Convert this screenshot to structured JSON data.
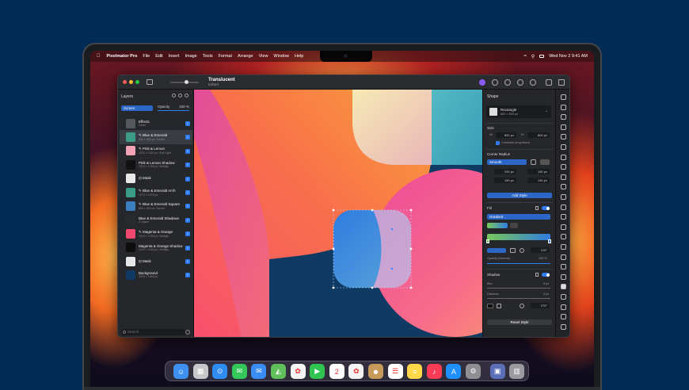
{
  "menubar": {
    "apple_icon": "apple-logo",
    "app_name": "Pixelmator Pro",
    "items": [
      "File",
      "Edit",
      "Insert",
      "Image",
      "Tools",
      "Format",
      "Arrange",
      "View",
      "Window",
      "Help"
    ],
    "datetime": "Wed Nov 2  9:41 AM"
  },
  "window": {
    "title": "Translucent",
    "subtitle": "Edited"
  },
  "layers_panel": {
    "title": "Layers",
    "blend_mode": "Screen",
    "opacity_label": "Opacity",
    "opacity_value": "100 %",
    "opacity_level": 1.0,
    "layers": [
      {
        "name": "Effects",
        "sub": "Glass",
        "thumb": "#55575c",
        "selected": false
      },
      {
        "name": "✎ Blue & Emerald",
        "sub": "800 × 800 px, Screen",
        "thumb": "#3d9a86",
        "selected": true
      },
      {
        "name": "✎ Pink & Lemon",
        "sub": "1024 × 1024 px, Soft Light",
        "thumb": "#f3a1b5",
        "selected": false
      },
      {
        "name": "Pink & Lemon Shadow",
        "sub": "1024 × 1024 px, Multiply",
        "thumb": "#111111",
        "selected": false
      },
      {
        "name": "⊡ Mask",
        "sub": "",
        "thumb": "#e8e8e8",
        "selected": false
      },
      {
        "name": "✎ Blue & Emerald Arch",
        "sub": "1074 × 1075 px",
        "thumb": "#3a9c84",
        "selected": false
      },
      {
        "name": "✎ Blue & Emerald Square",
        "sub": "800 × 800 px, Screen",
        "thumb": "#3b7fbf",
        "selected": false
      },
      {
        "name": "Blue & Emerald Shadows",
        "sub": "2 Layers",
        "thumb": "#2a2b2f",
        "selected": false
      },
      {
        "name": "✎ Magenta & Orange",
        "sub": "1024 × 1024 px, Multiply",
        "thumb": "#f0486f",
        "selected": false
      },
      {
        "name": "Magenta & Orange Shadow",
        "sub": "1024 × 1024 px, Multiply",
        "thumb": "#0d0d0d",
        "selected": false
      },
      {
        "name": "⊡ Mask",
        "sub": "",
        "thumb": "#e8e8e8",
        "selected": false
      },
      {
        "name": "Background",
        "sub": "3024 × 1964 px",
        "thumb": "#0f3a63",
        "selected": false
      }
    ],
    "search_placeholder": "Search"
  },
  "inspector": {
    "title": "Shape",
    "shape_name": "Rectangle",
    "shape_sub": "800 × 800 px",
    "size_label": "Size",
    "w_label": "W:",
    "w_value": "800 px",
    "h_label": "H:",
    "h_value": "800 px",
    "constrain_label": "Constrain proportions",
    "corner_label": "Corner Radius",
    "corner_mode": "Smooth",
    "corner_values": [
      "200 px",
      "150 px",
      "150 px",
      "150 px"
    ],
    "add_style_label": "Add Style",
    "fill_label": "Fill",
    "fill_type": "Gradient",
    "angle_value": "120°",
    "opacity_label": "Opacity (Normal)",
    "opacity_value": "100 %",
    "shadow_label": "Shadow",
    "blur_label": "Blur",
    "blur_value": "5 px",
    "distance_label": "Distance",
    "distance_value": "5 px",
    "shadow_angle": "270°",
    "reset_label": "Reset Style"
  },
  "dock": {
    "apps": [
      {
        "name": "finder-icon",
        "color": "#3d8ff0",
        "glyph": "☺"
      },
      {
        "name": "launchpad-icon",
        "color": "#c8c8cc",
        "glyph": "▦"
      },
      {
        "name": "safari-icon",
        "color": "#2f8cf3",
        "glyph": "⊙"
      },
      {
        "name": "messages-icon",
        "color": "#34c759",
        "glyph": "✉"
      },
      {
        "name": "mail-icon",
        "color": "#3a8cf5",
        "glyph": "✉"
      },
      {
        "name": "maps-icon",
        "color": "#5fbf5b",
        "glyph": "◭"
      },
      {
        "name": "photos-icon",
        "color": "#f4f4f4",
        "glyph": "✿"
      },
      {
        "name": "facetime-icon",
        "color": "#30c550",
        "glyph": "▶"
      },
      {
        "name": "calendar-icon",
        "color": "#ffffff",
        "glyph": "2"
      },
      {
        "name": "pixelmator-icon",
        "color": "#f3f3f3",
        "glyph": "✿"
      },
      {
        "name": "contacts-icon",
        "color": "#c69a5b",
        "glyph": "☻"
      },
      {
        "name": "reminders-icon",
        "color": "#ffffff",
        "glyph": "☰"
      },
      {
        "name": "notes-icon",
        "color": "#ffd84a",
        "glyph": "≡"
      },
      {
        "name": "music-icon",
        "color": "#fa3b55",
        "glyph": "♪"
      },
      {
        "name": "app-store-icon",
        "color": "#1e90ff",
        "glyph": "A"
      },
      {
        "name": "system-settings-icon",
        "color": "#8e8e93",
        "glyph": "⚙"
      },
      {
        "name": "preview-icon",
        "color": "#5a6fb8",
        "glyph": "▣"
      },
      {
        "name": "trash-icon",
        "color": "#9a9aa0",
        "glyph": "▥"
      }
    ],
    "calendar_month": "NOV",
    "calendar_day": "2"
  },
  "colors": {
    "background": "#032b57",
    "accent": "#2f7cf6"
  }
}
